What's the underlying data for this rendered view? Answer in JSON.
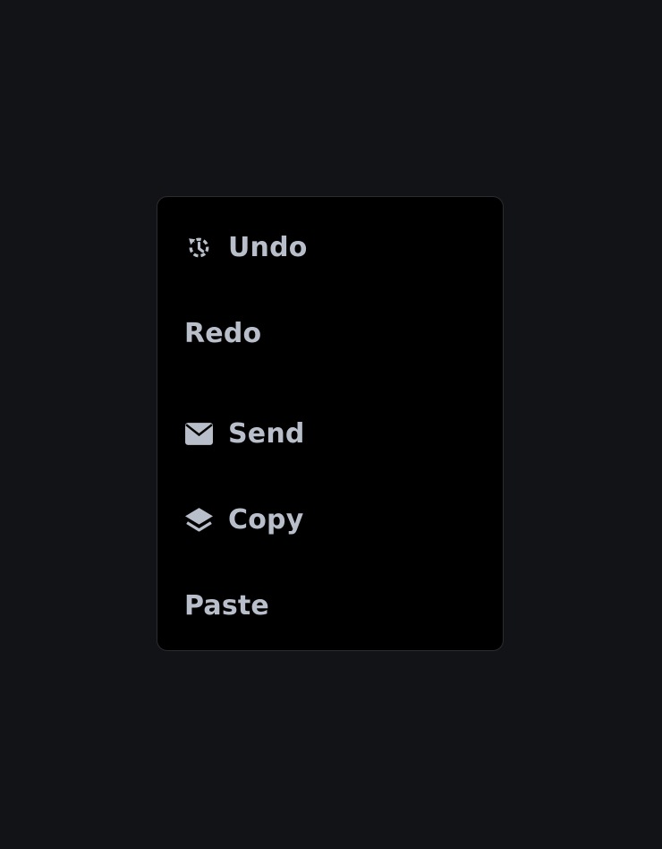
{
  "theme": {
    "page_background": "#121317",
    "menu_background": "#000000",
    "menu_border": "#2a2c31",
    "text_color": "#b9bfca"
  },
  "menu": {
    "items": [
      {
        "label": "Undo",
        "icon": "history-icon"
      },
      {
        "label": "Redo",
        "icon": null
      },
      {
        "label": "Send",
        "icon": "envelope-icon"
      },
      {
        "label": "Copy",
        "icon": "layers-icon"
      },
      {
        "label": "Paste",
        "icon": null
      }
    ]
  }
}
